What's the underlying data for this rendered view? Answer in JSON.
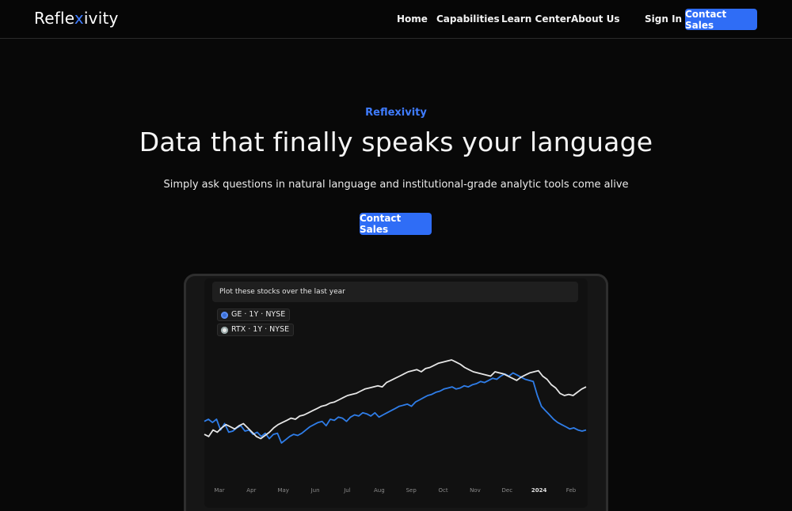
{
  "brand": {
    "logo_prefix": "Refle",
    "logo_x": "x",
    "logo_suffix": "ivity"
  },
  "nav": {
    "home": "Home",
    "capabilities": "Capabilities",
    "learn_center": "Learn Center",
    "about_us": "About Us",
    "sign_in": "Sign In",
    "contact_sales": "Contact Sales"
  },
  "hero": {
    "kicker": "Reflexivity",
    "title": "Data that finally speaks your language",
    "subtitle": "Simply ask questions in natural language and institutional-grade analytic tools come alive",
    "cta": "Contact Sales"
  },
  "demo": {
    "prompt": "Plot these stocks over the last year",
    "chips": [
      {
        "label": "GE · 1Y · NYSE",
        "icon": "ge-logo-icon"
      },
      {
        "label": "RTX · 1Y · NYSE",
        "icon": "rtx-logo-icon"
      }
    ]
  },
  "colors": {
    "accent": "#2f6df6",
    "series_ge": "#2f7de8",
    "series_rtx": "#e6e6e6"
  },
  "chart_data": {
    "type": "line",
    "x": [
      "Mar",
      "Apr",
      "May",
      "Jun",
      "Jul",
      "Aug",
      "Sep",
      "Oct",
      "Nov",
      "Dec",
      "2024",
      "Feb"
    ],
    "emphasized_tick": "2024",
    "yaxis_visible": false,
    "grid": false,
    "series": [
      {
        "name": "GE",
        "color": "#2f7de8",
        "values": [
          58,
          60,
          57,
          60,
          50,
          56,
          48,
          49,
          52,
          54,
          49,
          50,
          46,
          48,
          44,
          47,
          42,
          46,
          47,
          38,
          41,
          44,
          46,
          45,
          47,
          50,
          53,
          55,
          57,
          58,
          54,
          60,
          59,
          62,
          61,
          58,
          62,
          64,
          63,
          66,
          65,
          63,
          66,
          62,
          64,
          66,
          68,
          70,
          72,
          73,
          74,
          72,
          76,
          78,
          80,
          82,
          83,
          85,
          86,
          88,
          89,
          90,
          88,
          89,
          91,
          90,
          92,
          93,
          95,
          94,
          96,
          98,
          97,
          100,
          102,
          100,
          103,
          101,
          99,
          97,
          96,
          95,
          82,
          72,
          68,
          64,
          60,
          57,
          55,
          53,
          51,
          52,
          50,
          49,
          50
        ]
      },
      {
        "name": "RTX",
        "color": "#e6e6e6",
        "values": [
          46,
          44,
          50,
          48,
          52,
          55,
          53,
          51,
          54,
          56,
          52,
          48,
          44,
          42,
          45,
          48,
          52,
          55,
          57,
          59,
          61,
          60,
          63,
          64,
          66,
          68,
          70,
          72,
          73,
          75,
          76,
          78,
          80,
          82,
          83,
          84,
          86,
          88,
          89,
          90,
          91,
          90,
          94,
          96,
          98,
          100,
          102,
          104,
          105,
          106,
          104,
          107,
          108,
          110,
          112,
          113,
          114,
          115,
          113,
          111,
          108,
          106,
          104,
          103,
          102,
          101,
          100,
          104,
          103,
          102,
          100,
          98,
          96,
          99,
          101,
          103,
          104,
          105,
          100,
          97,
          92,
          89,
          84,
          82,
          83,
          82,
          85,
          88,
          90
        ]
      }
    ]
  }
}
